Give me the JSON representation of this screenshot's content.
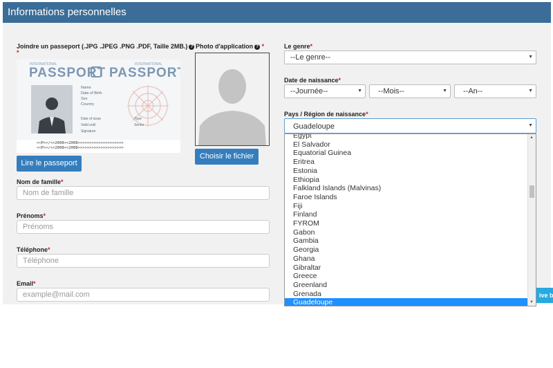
{
  "header": {
    "title": "Informations personnelles"
  },
  "passport_section": {
    "label": "Joindre un passeport (.JPG .JPEG .PNG .PDF, Taille 2MB.)",
    "required_mark": "*",
    "image": {
      "top_small_left": "INTERNATIONAL",
      "top_small_right": "INTERNATIONAL",
      "word_left": "PASSPORT",
      "word_right": "PASSPORT",
      "fields": [
        "Name",
        "Date of Birth",
        "Sex",
        "Country"
      ],
      "row2_left": [
        "Date of issue",
        "Valid until",
        "Signature"
      ],
      "row2_right": [
        "Type",
        "Series"
      ],
      "mrz_line1": "<<P>>/<<2008<<2008>>>>>>>>>>>>>>>>>>>>",
      "mrz_line2": "<<P>>/<<2008<<2008>>>>>>>>>>>>>>>>>>>>"
    },
    "button": "Lire le passeport"
  },
  "photo_section": {
    "label": "Photo d'application",
    "required_mark": "*",
    "button": "Choisir le fichier"
  },
  "fields": {
    "nom": {
      "label": "Nom de famille",
      "placeholder": "Nom de famille"
    },
    "prenoms": {
      "label": "Prénoms",
      "placeholder": "Prénoms"
    },
    "telephone": {
      "label": "Téléphone",
      "placeholder": "Téléphone"
    },
    "email": {
      "label": "Email",
      "placeholder": "example@mail.com"
    }
  },
  "genre": {
    "label": "Le genre",
    "value": "--Le genre--"
  },
  "naissance": {
    "label": "Date de naissance",
    "day": "--Journée--",
    "month": "--Mois--",
    "year": "--An--"
  },
  "pays": {
    "label": "Pays / Région de naissance",
    "value": "Guadeloupe",
    "options": [
      "Egypt",
      "El Salvador",
      "Equatorial Guinea",
      "Eritrea",
      "Estonia",
      "Ethiopia",
      "Falkland Islands (Malvinas)",
      "Faroe Islands",
      "Fiji",
      "Finland",
      "FYROM",
      "Gabon",
      "Gambia",
      "Georgia",
      "Ghana",
      "Gibraltar",
      "Greece",
      "Greenland",
      "Grenada",
      "Guadeloupe"
    ],
    "selected_index": 19
  },
  "live_chat": {
    "label": "ive be"
  },
  "icons": {
    "help": "question-circle-icon",
    "dropdown": "caret-down-icon",
    "avatar": "person-silhouette-icon"
  },
  "colors": {
    "header": "#3b6d98",
    "button": "#357ebd",
    "selected": "#1e90ff",
    "live": "#27a9e1"
  }
}
